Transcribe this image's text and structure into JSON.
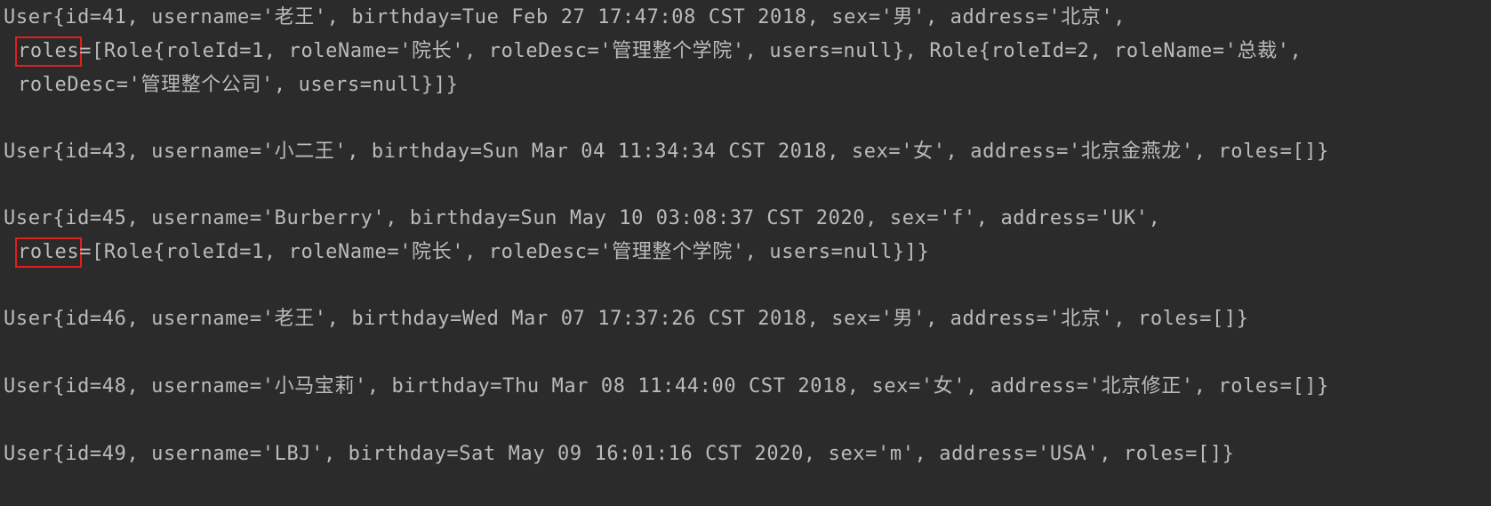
{
  "console": {
    "records": [
      {
        "lines": [
          {
            "text": "User{id=41, username='老王', birthday=Tue Feb 27 17:47:08 CST 2018, sex='男', address='北京',"
          },
          {
            "highlight": "roles",
            "rest": "=[Role{roleId=1, roleName='院长', roleDesc='管理整个学院', users=null}, Role{roleId=2, roleName='总裁',"
          },
          {
            "text": "roleDesc='管理整个公司', users=null}]}"
          }
        ]
      },
      {
        "lines": [
          {
            "text": "User{id=43, username='小二王', birthday=Sun Mar 04 11:34:34 CST 2018, sex='女', address='北京金燕龙', roles=[]}"
          }
        ]
      },
      {
        "lines": [
          {
            "text": "User{id=45, username='Burberry', birthday=Sun May 10 03:08:37 CST 2020, sex='f', address='UK',"
          },
          {
            "highlight": "roles",
            "rest": "=[Role{roleId=1, roleName='院长', roleDesc='管理整个学院', users=null}]}"
          }
        ]
      },
      {
        "lines": [
          {
            "text": "User{id=46, username='老王', birthday=Wed Mar 07 17:37:26 CST 2018, sex='男', address='北京', roles=[]}"
          }
        ]
      },
      {
        "lines": [
          {
            "text": "User{id=48, username='小马宝莉', birthday=Thu Mar 08 11:44:00 CST 2018, sex='女', address='北京修正', roles=[]}"
          }
        ]
      },
      {
        "lines": [
          {
            "text": "User{id=49, username='LBJ', birthday=Sat May 09 16:01:16 CST 2020, sex='m', address='USA', roles=[]}"
          }
        ]
      }
    ]
  }
}
